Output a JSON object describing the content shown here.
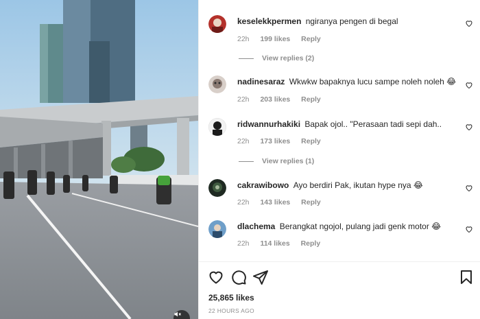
{
  "post": {
    "likes_count": "25,865 likes",
    "time_ago": "22 HOURS AGO"
  },
  "comments": [
    {
      "username": "keselekkpermen",
      "text": "ngiranya pengen di begal",
      "time": "22h",
      "likes": "199 likes",
      "reply": "Reply",
      "view_replies": "View replies (2)"
    },
    {
      "username": "nadinesaraz",
      "text": "Wkwkw bapaknya lucu sampe noleh noleh 😂",
      "time": "22h",
      "likes": "203 likes",
      "reply": "Reply"
    },
    {
      "username": "ridwannurhakiki",
      "text": "Bapak ojol.. \"Perasaan tadi sepi dah..",
      "time": "22h",
      "likes": "173 likes",
      "reply": "Reply",
      "view_replies": "View replies (1)"
    },
    {
      "username": "cakrawibowo",
      "text": "Ayo berdiri Pak, ikutan hype nya 😂",
      "time": "22h",
      "likes": "143 likes",
      "reply": "Reply"
    },
    {
      "username": "dlachema",
      "text": "Berangkat ngojol, pulang jadi genk motor 😂",
      "time": "22h",
      "likes": "114 likes",
      "reply": "Reply"
    }
  ],
  "icons": {
    "like": "heart-icon",
    "comment": "comment-icon",
    "share": "share-icon",
    "save": "bookmark-icon",
    "mute": "speaker-muted-icon"
  },
  "colors": {
    "text_primary": "#262626",
    "text_secondary": "#8e8e8e",
    "divider": "#efefef"
  }
}
